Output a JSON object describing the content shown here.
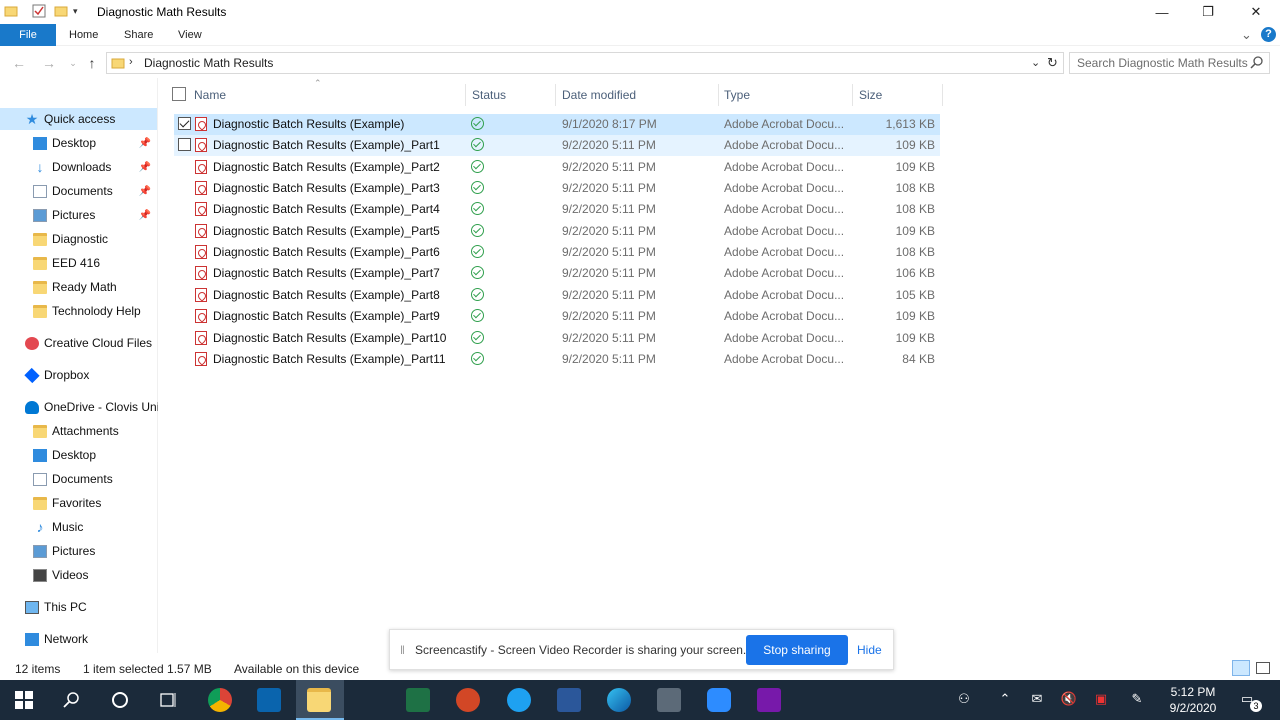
{
  "window": {
    "title": "Diagnostic Math Results",
    "controls": {
      "minimize": "—",
      "restore": "❐",
      "close": "✕"
    }
  },
  "ribbon": {
    "tabs": [
      "File",
      "Home",
      "Share",
      "View"
    ],
    "collapse_glyph": "⌄",
    "help_glyph": "?"
  },
  "address": {
    "path": "Diagnostic Math Results",
    "search_placeholder": "Search Diagnostic Math Results"
  },
  "nav": {
    "items": [
      {
        "label": "Quick access",
        "icon": "star-icon"
      },
      {
        "label": "Desktop",
        "icon": "desktop-icon",
        "pinned": true
      },
      {
        "label": "Downloads",
        "icon": "download-icon",
        "pinned": true
      },
      {
        "label": "Documents",
        "icon": "documents-icon",
        "pinned": true
      },
      {
        "label": "Pictures",
        "icon": "pictures-icon",
        "pinned": true
      },
      {
        "label": "Diagnostic",
        "icon": "folder-icon"
      },
      {
        "label": "EED 416",
        "icon": "folder-icon"
      },
      {
        "label": "Ready Math",
        "icon": "folder-icon"
      },
      {
        "label": "Technolody Help",
        "icon": "folder-icon"
      },
      {
        "label": "Creative Cloud Files",
        "icon": "creative-cloud-icon"
      },
      {
        "label": "Dropbox",
        "icon": "dropbox-icon"
      },
      {
        "label": "OneDrive - Clovis Uni",
        "icon": "onedrive-icon"
      },
      {
        "label": "Attachments",
        "icon": "folder-icon"
      },
      {
        "label": "Desktop",
        "icon": "desktop-icon"
      },
      {
        "label": "Documents",
        "icon": "documents-icon"
      },
      {
        "label": "Favorites",
        "icon": "folder-icon"
      },
      {
        "label": "Music",
        "icon": "music-icon"
      },
      {
        "label": "Pictures",
        "icon": "pictures-icon"
      },
      {
        "label": "Videos",
        "icon": "videos-icon"
      },
      {
        "label": "This PC",
        "icon": "pc-icon"
      },
      {
        "label": "Network",
        "icon": "network-icon"
      }
    ]
  },
  "columns": {
    "name": "Name",
    "status": "Status",
    "date": "Date modified",
    "type": "Type",
    "size": "Size"
  },
  "files": [
    {
      "name": "Diagnostic Batch Results (Example)",
      "date": "9/1/2020 8:17 PM",
      "type": "Adobe Acrobat Docu...",
      "size": "1,613 KB",
      "state": "selected"
    },
    {
      "name": "Diagnostic Batch Results (Example)_Part1",
      "date": "9/2/2020 5:11 PM",
      "type": "Adobe Acrobat Docu...",
      "size": "109 KB",
      "state": "hover"
    },
    {
      "name": "Diagnostic Batch Results (Example)_Part2",
      "date": "9/2/2020 5:11 PM",
      "type": "Adobe Acrobat Docu...",
      "size": "109 KB",
      "state": ""
    },
    {
      "name": "Diagnostic Batch Results (Example)_Part3",
      "date": "9/2/2020 5:11 PM",
      "type": "Adobe Acrobat Docu...",
      "size": "108 KB",
      "state": ""
    },
    {
      "name": "Diagnostic Batch Results (Example)_Part4",
      "date": "9/2/2020 5:11 PM",
      "type": "Adobe Acrobat Docu...",
      "size": "108 KB",
      "state": ""
    },
    {
      "name": "Diagnostic Batch Results (Example)_Part5",
      "date": "9/2/2020 5:11 PM",
      "type": "Adobe Acrobat Docu...",
      "size": "109 KB",
      "state": ""
    },
    {
      "name": "Diagnostic Batch Results (Example)_Part6",
      "date": "9/2/2020 5:11 PM",
      "type": "Adobe Acrobat Docu...",
      "size": "108 KB",
      "state": ""
    },
    {
      "name": "Diagnostic Batch Results (Example)_Part7",
      "date": "9/2/2020 5:11 PM",
      "type": "Adobe Acrobat Docu...",
      "size": "106 KB",
      "state": ""
    },
    {
      "name": "Diagnostic Batch Results (Example)_Part8",
      "date": "9/2/2020 5:11 PM",
      "type": "Adobe Acrobat Docu...",
      "size": "105 KB",
      "state": ""
    },
    {
      "name": "Diagnostic Batch Results (Example)_Part9",
      "date": "9/2/2020 5:11 PM",
      "type": "Adobe Acrobat Docu...",
      "size": "109 KB",
      "state": ""
    },
    {
      "name": "Diagnostic Batch Results (Example)_Part10",
      "date": "9/2/2020 5:11 PM",
      "type": "Adobe Acrobat Docu...",
      "size": "109 KB",
      "state": ""
    },
    {
      "name": "Diagnostic Batch Results (Example)_Part11",
      "date": "9/2/2020 5:11 PM",
      "type": "Adobe Acrobat Docu...",
      "size": "84 KB",
      "state": ""
    }
  ],
  "statusbar": {
    "count": "12 items",
    "selected": "1 item selected  1.57 MB",
    "availability": "Available on this device"
  },
  "banner": {
    "message": "Screencastify - Screen Video Recorder is sharing your screen.",
    "stop_label": "Stop sharing",
    "hide_label": "Hide"
  },
  "taskbar": {
    "time": "5:12 PM",
    "date": "9/2/2020",
    "notification_count": "3",
    "apps": [
      "windows-start-icon",
      "search-icon",
      "cortana-icon",
      "task-view-icon",
      "chrome-icon",
      "outlook-icon",
      "file-explorer-icon",
      "excel-icon",
      "powerpoint-icon",
      "internet-explorer-icon",
      "word-icon",
      "edge-icon",
      "camera-icon",
      "zoom-icon",
      "onenote-icon"
    ],
    "colors": {
      "bar": "#1b2a3a",
      "accent": "#1979ca",
      "selection": "#cce8ff",
      "status_ok": "#31a04e",
      "banner_button": "#1a73e8"
    }
  }
}
